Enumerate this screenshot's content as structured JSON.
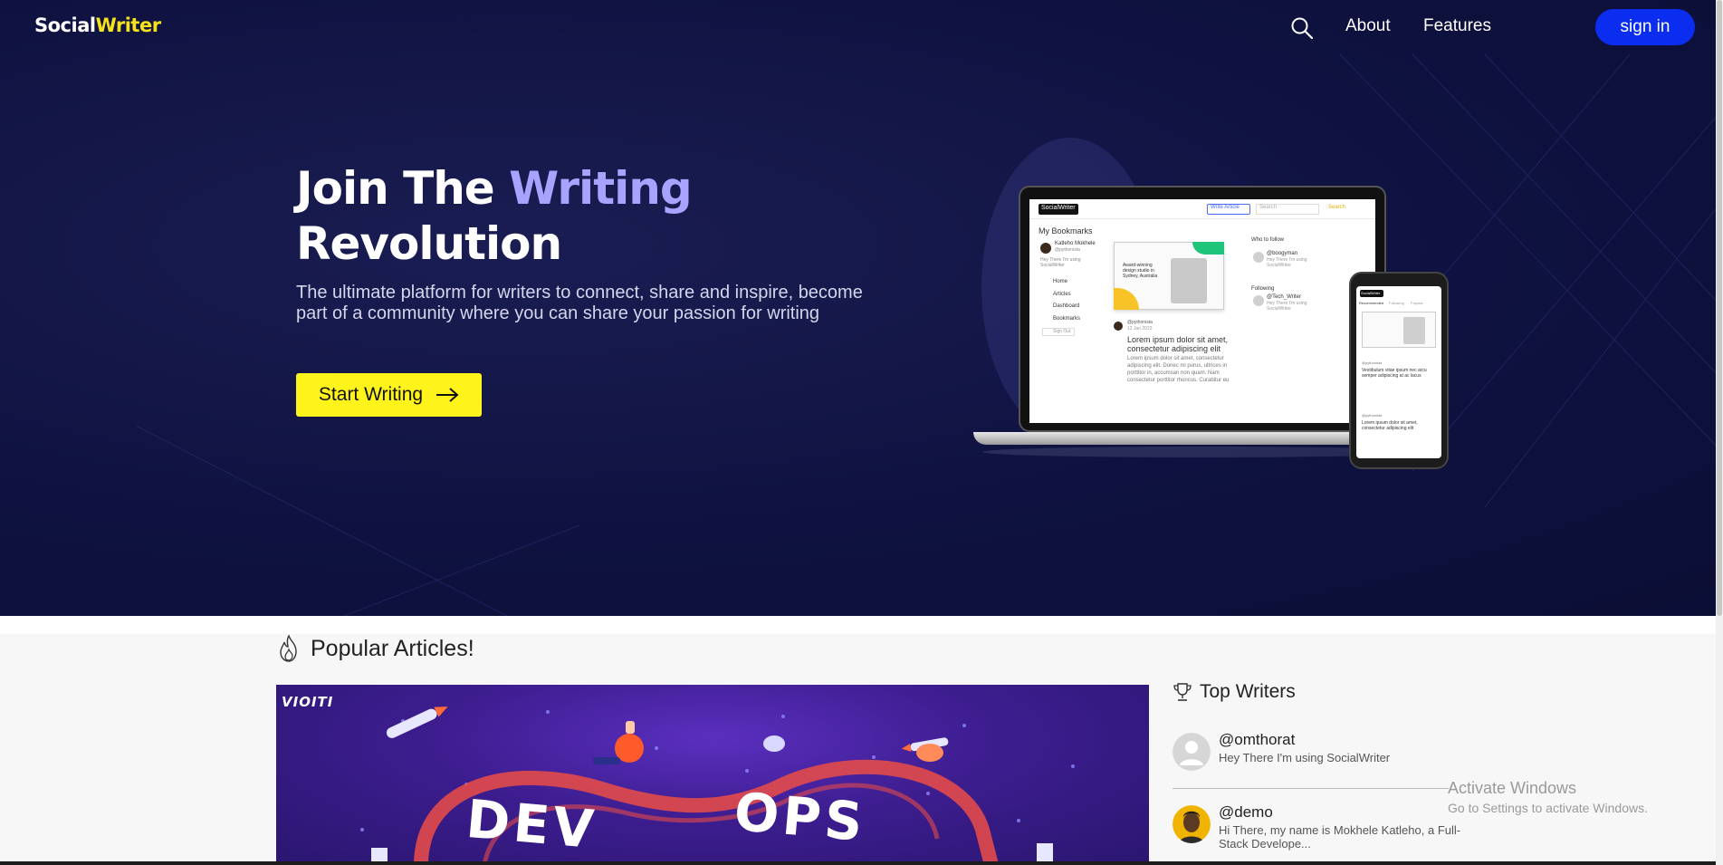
{
  "nav": {
    "brand_main": "Social",
    "brand_accent": "Writer",
    "search_icon": "search-icon",
    "links": {
      "about": "About",
      "features": "Features"
    },
    "signin_label": "sign in"
  },
  "hero": {
    "title_part1": "Join The ",
    "title_highlight": "Writing",
    "title_part2": "Revolution",
    "subtitle": "The ultimate platform for writers to connect, share and inspire, become part of a community where you can share your passion for writing",
    "cta_label": "Start Writing",
    "cta_icon": "arrow-right-icon"
  },
  "mockup": {
    "laptop": {
      "brand": "SocialWriter",
      "write_article": "Write Article",
      "search_placeholder": "Search",
      "search_button": "Search",
      "page_heading": "My Bookmarks",
      "profile_name": "Katleho Mokhele",
      "profile_handle": "@pythonista",
      "profile_bio": "Hey There I'm using SocialWriter",
      "menu": [
        "Home",
        "Articles",
        "Dashboard",
        "Bookmarks"
      ],
      "sign_out": "Sign Out",
      "card_text": "Award-winning design studio in Sydney, Australia",
      "post_handle": "@pythonista",
      "post_date": "12 Jan 2023",
      "post_title": "Lorem ipsum dolor sit amet, consectetur adipiscing elit",
      "post_body": "Lorem ipsum dolor sit amet, consectetur adipiscing elit. Donec mi purus, ultrices in porttitor in, accumsan non quam. Nam consectetur porttitor rhoncus. Curabitur eu",
      "who_to_follow": "Who to follow",
      "follow_user": "@boogyman",
      "follow_bio": "Hey There I'm using SocialWriter",
      "following_label": "Following",
      "following_user": "@Tech_Writer",
      "following_bio": "Hey There I'm using SocialWriter"
    },
    "phone": {
      "brand": "SocialWriter",
      "tabs": [
        "Recommended",
        "Following",
        "Popular"
      ],
      "post1_handle": "@pythonista",
      "post1_title": "Vestibulum vitae ipsum nec arcu semper adipiscing at ac lacus",
      "post2_handle": "@pythonista",
      "post2_title": "Lorem ipsum dolor sit amet, consectetur adipiscing elit"
    }
  },
  "popular": {
    "title": "Popular Articles!",
    "icon": "fire-icon",
    "featured": {
      "image_text_left": "DEV",
      "image_text_right": "OPS",
      "corner_text": "VIOITI"
    }
  },
  "writers": {
    "title": "Top Writers",
    "icon": "trophy-icon",
    "list": [
      {
        "handle": "@omthorat",
        "bio": "Hey There I'm using SocialWriter"
      },
      {
        "handle": "@demo",
        "bio": "Hi There, my name is Mokhele Katleho, a Full-Stack Develope..."
      }
    ]
  },
  "watermark": {
    "title": "Activate Windows",
    "subtitle": "Go to Settings to activate Windows."
  },
  "colors": {
    "hero_bg": "#0f1240",
    "brand_accent": "#f5e21b",
    "title_highlight": "#a8a3ff",
    "signin_bg": "#0b2df0",
    "cta_bg": "#fff31c"
  }
}
